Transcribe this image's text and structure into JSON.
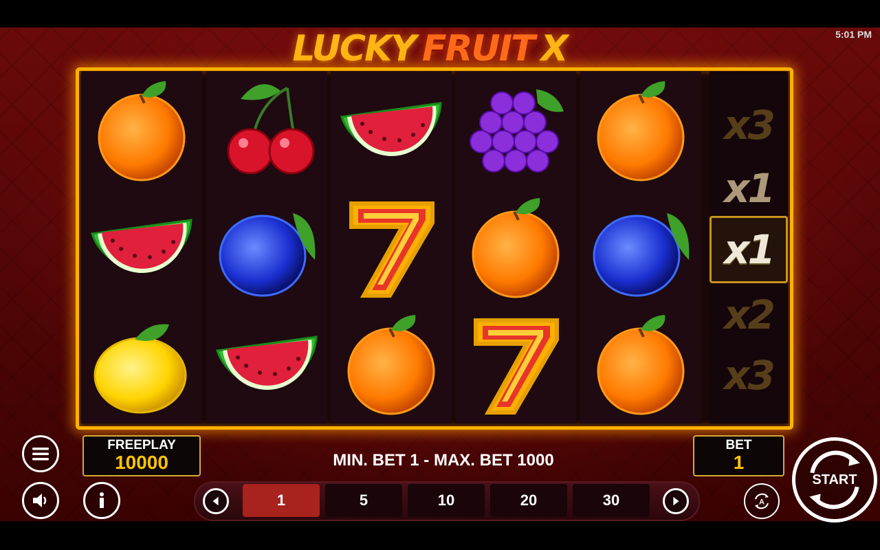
{
  "status_bar": {
    "time": "5:01 PM"
  },
  "logo": {
    "word1": "LUCKY",
    "word2": "FRUIT",
    "word3": "X"
  },
  "reels": [
    [
      "orange",
      "watermelon",
      "lemon"
    ],
    [
      "cherry",
      "plum",
      "watermelon"
    ],
    [
      "watermelon",
      "seven",
      "orange"
    ],
    [
      "grapes",
      "orange",
      "seven"
    ],
    [
      "orange",
      "plum",
      "orange"
    ]
  ],
  "multipliers": [
    {
      "label": "x3",
      "state": "dim"
    },
    {
      "label": "x1",
      "state": "mid"
    },
    {
      "label": "x1",
      "state": "active"
    },
    {
      "label": "x2",
      "state": "dim"
    },
    {
      "label": "x3",
      "state": "dim"
    }
  ],
  "freeplay": {
    "label": "FREEPLAY",
    "value": "10000"
  },
  "bet": {
    "label": "BET",
    "value": "1"
  },
  "bet_limits": "MIN. BET 1 - MAX. BET 1000",
  "bet_options": [
    "1",
    "5",
    "10",
    "20",
    "30"
  ],
  "selected_bet_index": 0,
  "start_label": "START",
  "icons": {
    "menu": "menu-icon",
    "sound": "speaker-icon",
    "info": "info-icon",
    "autoplay": "autoplay-icon",
    "prev": "chevron-left-icon",
    "next": "chevron-right-icon"
  },
  "colors": {
    "frame": "#ffb000",
    "accent": "#ffc400",
    "selected_bet": "#a8221e"
  }
}
